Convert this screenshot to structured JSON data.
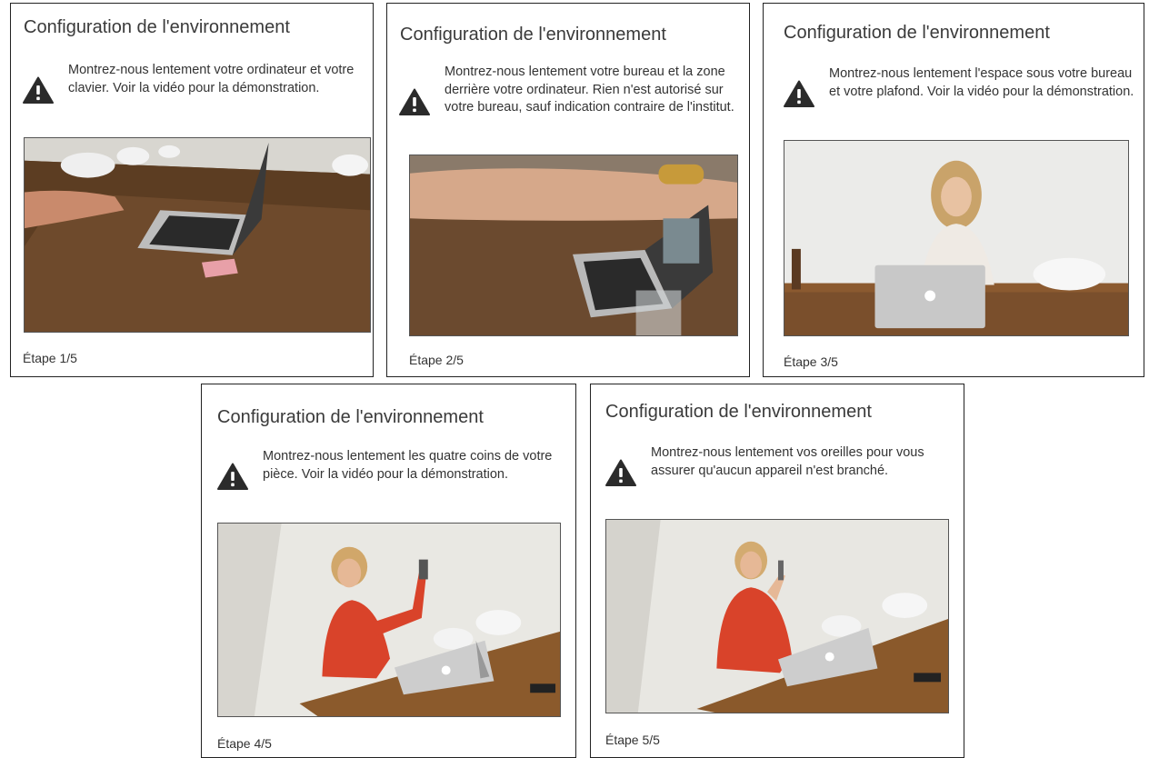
{
  "cards": [
    {
      "title": "Configuration de l'environnement",
      "instruction": "Montrez-nous lentement votre ordinateur et votre clavier. Voir la vidéo pour la démonstration.",
      "step": "Étape 1/5"
    },
    {
      "title": "Configuration de l'environnement",
      "instruction": "Montrez-nous lentement votre bureau et la zone derrière votre ordinateur. Rien n'est autorisé sur votre bureau, sauf indication contraire de l'institut.",
      "step": "Étape 2/5"
    },
    {
      "title": "Configuration de l'environnement",
      "instruction": "Montrez-nous lentement l'espace sous votre bureau et votre plafond. Voir la vidéo pour la démonstration.",
      "step": "Étape 3/5"
    },
    {
      "title": "Configuration de l'environnement",
      "instruction": "Montrez-nous lentement les quatre coins de votre pièce. Voir la vidéo pour la démonstration.",
      "step": "Étape 4/5"
    },
    {
      "title": "Configuration de l'environnement",
      "instruction": "Montrez-nous lentement vos oreilles pour vous assurer qu'aucun appareil n'est branché.",
      "step": "Étape 5/5"
    }
  ],
  "icons": {
    "warning": "warning-triangle-icon"
  },
  "colors": {
    "border": "#222222",
    "text": "#333333",
    "icon": "#2b2b2b"
  }
}
